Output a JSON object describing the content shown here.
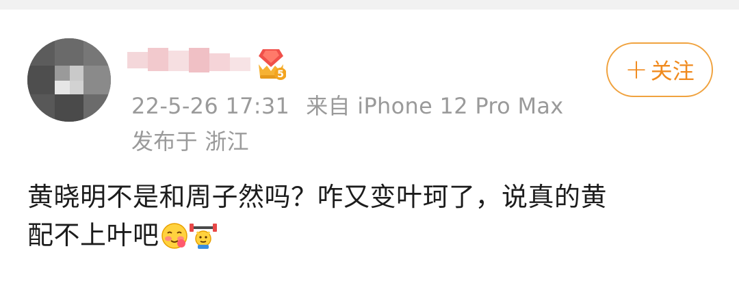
{
  "post": {
    "time": "22-5-26 17:31",
    "source": "来自 iPhone 12 Pro Max",
    "location": "发布于 浙江",
    "follow_label": "关注",
    "follow_plus": "+",
    "badge_level": "5",
    "text_line1": "黄晓明不是和周子然吗？咋又变叶珂了，说真的黄",
    "text_line2": "配不上叶吧",
    "emojis": [
      "blushing-face-icon",
      "weightlifting-icon"
    ]
  },
  "colors": {
    "accent": "#f08a1e",
    "meta_text": "#9a9a9a",
    "body_text": "#1c1c1c"
  }
}
